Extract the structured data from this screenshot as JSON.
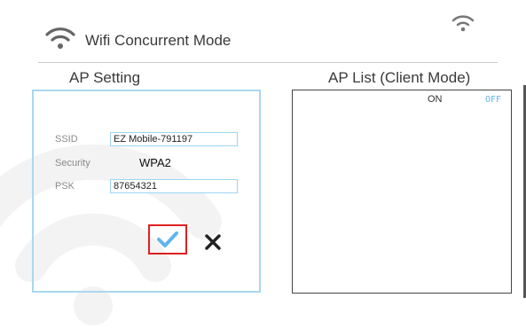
{
  "header": {
    "title": "Wifi Concurrent Mode",
    "wifi_icon": "wifi-icon",
    "status_wifi_icon": "wifi-status-icon"
  },
  "ap_setting": {
    "title": "AP Setting",
    "ssid_label": "SSID",
    "ssid_value": "EZ Mobile-791197",
    "security_label": "Security",
    "security_value": "WPA2",
    "psk_label": "PSK",
    "psk_value": "87654321",
    "confirm_icon": "checkmark-icon",
    "cancel_icon": "close-icon"
  },
  "ap_list": {
    "title": "AP List (Client Mode)",
    "toggle_on_label": "ON",
    "toggle_off_label": "OFF"
  },
  "colors": {
    "accent_blue": "#5fb6ee",
    "field_border": "#9fd3ef",
    "highlight_red": "#e02020"
  }
}
